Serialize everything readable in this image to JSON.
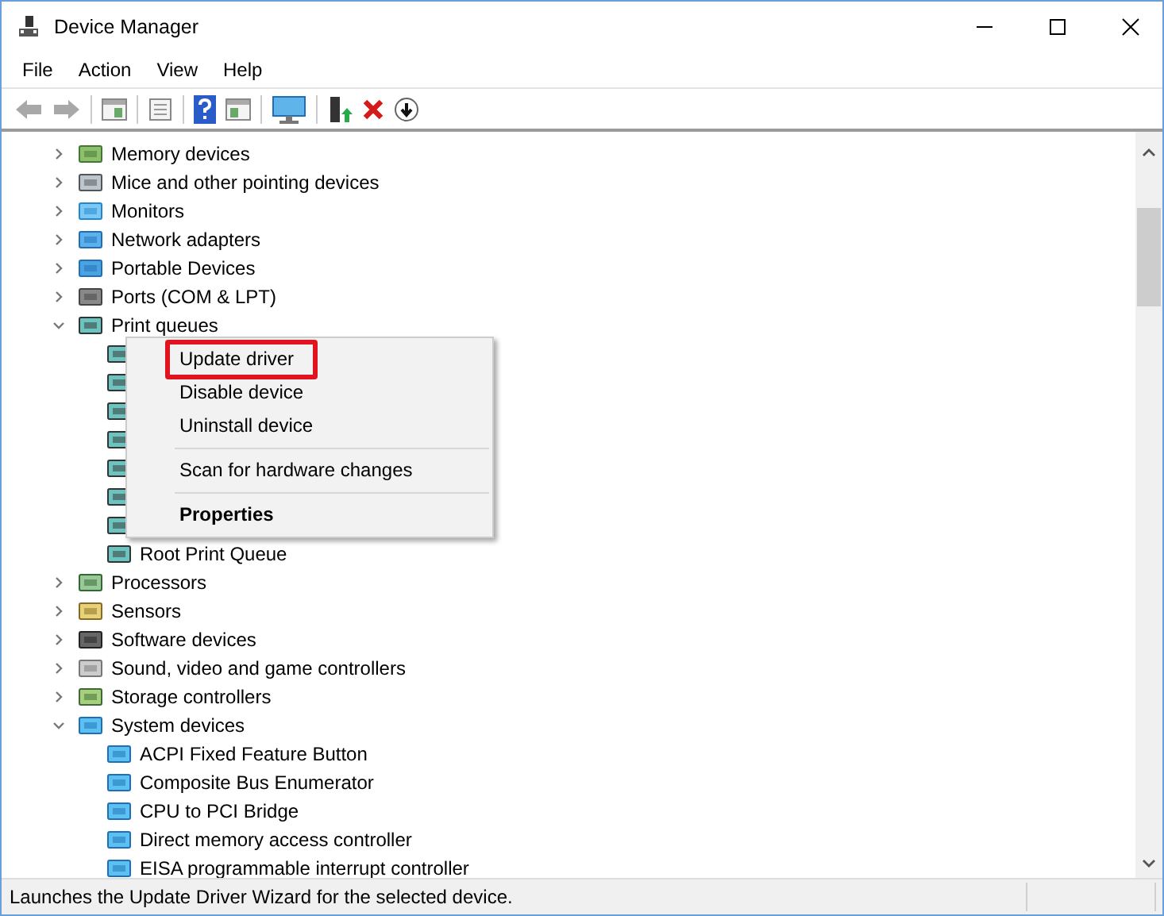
{
  "window": {
    "title": "Device Manager"
  },
  "menu_bar": [
    "File",
    "Action",
    "View",
    "Help"
  ],
  "tree": [
    {
      "label": "Memory devices",
      "kind": "memory",
      "expanded": false
    },
    {
      "label": "Mice and other pointing devices",
      "kind": "mouse",
      "expanded": false
    },
    {
      "label": "Monitors",
      "kind": "monitor",
      "expanded": false
    },
    {
      "label": "Network adapters",
      "kind": "network",
      "expanded": false
    },
    {
      "label": "Portable Devices",
      "kind": "portable",
      "expanded": false
    },
    {
      "label": "Ports (COM & LPT)",
      "kind": "port",
      "expanded": false
    },
    {
      "label": "Print queues",
      "kind": "printer",
      "expanded": true,
      "children": [
        {
          "kind": "printer"
        },
        {
          "kind": "printer"
        },
        {
          "kind": "printer"
        },
        {
          "kind": "printer"
        },
        {
          "kind": "printer"
        },
        {
          "kind": "printer"
        },
        {
          "kind": "printer"
        },
        {
          "label": "Root Print Queue",
          "kind": "printer"
        }
      ]
    },
    {
      "label": "Processors",
      "kind": "processor",
      "expanded": false
    },
    {
      "label": "Sensors",
      "kind": "sensor",
      "expanded": false
    },
    {
      "label": "Software devices",
      "kind": "software",
      "expanded": false
    },
    {
      "label": "Sound, video and game controllers",
      "kind": "sound",
      "expanded": false
    },
    {
      "label": "Storage controllers",
      "kind": "storage",
      "expanded": false
    },
    {
      "label": "System devices",
      "kind": "system",
      "expanded": true,
      "children": [
        {
          "label": "ACPI Fixed Feature Button",
          "kind": "system"
        },
        {
          "label": "Composite Bus Enumerator",
          "kind": "system"
        },
        {
          "label": "CPU to PCI Bridge",
          "kind": "system"
        },
        {
          "label": "Direct memory access controller",
          "kind": "system"
        },
        {
          "label": "EISA programmable interrupt controller",
          "kind": "system"
        }
      ]
    }
  ],
  "context_menu": [
    {
      "kind": "item",
      "label": "Update driver",
      "annotated": true,
      "default": false
    },
    {
      "kind": "item",
      "label": "Disable device",
      "annotated": false,
      "default": false
    },
    {
      "kind": "item",
      "label": "Uninstall device",
      "annotated": false,
      "default": false
    },
    {
      "kind": "separator"
    },
    {
      "kind": "item",
      "label": "Scan for hardware changes",
      "annotated": false,
      "default": false
    },
    {
      "kind": "separator"
    },
    {
      "kind": "item",
      "label": "Properties",
      "annotated": false,
      "default": true
    }
  ],
  "status_bar": "Launches the Update Driver Wizard for the selected device."
}
